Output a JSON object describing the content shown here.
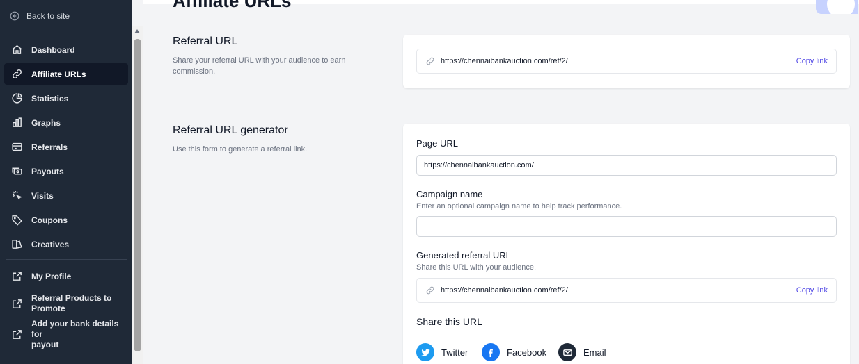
{
  "sidebar": {
    "back_label": "Back to site",
    "items": [
      {
        "label": "Dashboard",
        "icon": "home-icon"
      },
      {
        "label": "Affiliate URLs",
        "icon": "link-icon"
      },
      {
        "label": "Statistics",
        "icon": "pie-chart-icon"
      },
      {
        "label": "Graphs",
        "icon": "bar-chart-icon"
      },
      {
        "label": "Referrals",
        "icon": "card-icon"
      },
      {
        "label": "Payouts",
        "icon": "cash-icon"
      },
      {
        "label": "Visits",
        "icon": "cursor-click-icon"
      },
      {
        "label": "Coupons",
        "icon": "tag-icon"
      },
      {
        "label": "Creatives",
        "icon": "creatives-icon"
      }
    ],
    "links": [
      {
        "label": "My Profile",
        "icon": "external-link-icon"
      },
      {
        "label_line1": "Referral Products to",
        "label_line2": "Promote",
        "icon": "external-link-icon"
      },
      {
        "label_line1": "Add your bank details for",
        "label_line2": "payout",
        "icon": "external-link-icon"
      }
    ]
  },
  "page": {
    "title": "Affiliate URLs"
  },
  "referral_url": {
    "title": "Referral URL",
    "description": "Share your referral URL with your audience to earn commission.",
    "url": "https://chennaibankauction.com/ref/2/",
    "copy_label": "Copy link"
  },
  "generator": {
    "title": "Referral URL generator",
    "description": "Use this form to generate a referral link.",
    "page_url_label": "Page URL",
    "page_url_value": "https://chennaibankauction.com/",
    "campaign_label": "Campaign name",
    "campaign_hint": "Enter an optional campaign name to help track performance.",
    "campaign_value": "",
    "generated_label": "Generated referral URL",
    "generated_hint": "Share this URL with your audience.",
    "generated_url": "https://chennaibankauction.com/ref/2/",
    "copy_label": "Copy link",
    "share_title": "Share this URL",
    "share": [
      {
        "label": "Twitter",
        "icon": "twitter-icon",
        "color": "#1d9bf0"
      },
      {
        "label": "Facebook",
        "icon": "facebook-icon",
        "color": "#1877f2"
      },
      {
        "label": "Email",
        "icon": "email-icon",
        "color": "#1f2937"
      }
    ]
  },
  "colors": {
    "sidebar_bg": "#1f2937",
    "accent": "#4f46e5",
    "page_bg": "#f3f4f6"
  }
}
